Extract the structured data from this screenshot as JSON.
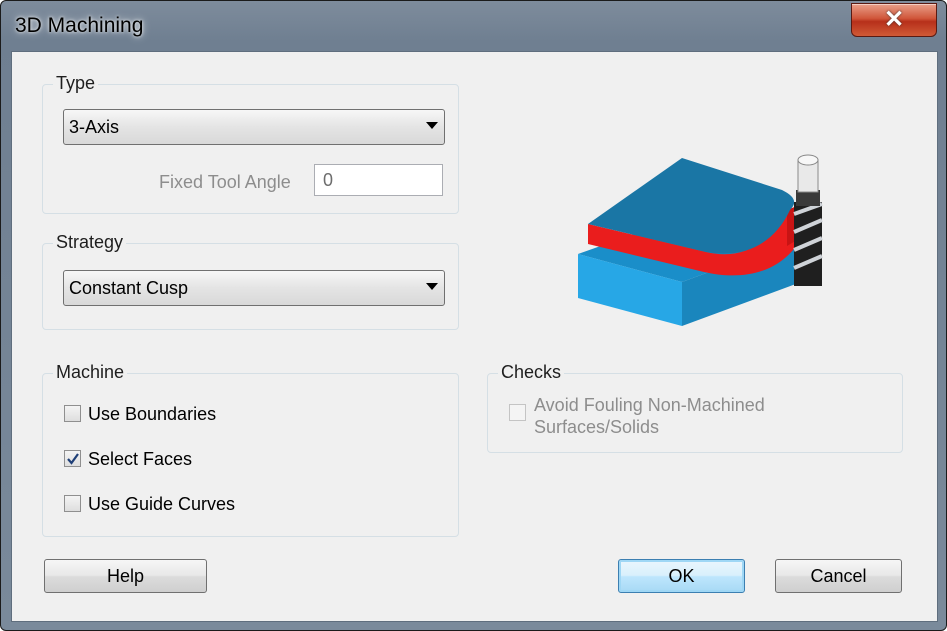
{
  "window": {
    "title": "3D Machining",
    "close_glyph": "✕"
  },
  "type_group": {
    "label": "Type",
    "selected": "3-Axis",
    "fixed_tool_angle_label": "Fixed Tool Angle",
    "fixed_tool_angle_value": "0"
  },
  "strategy_group": {
    "label": "Strategy",
    "selected": "Constant Cusp"
  },
  "machine_group": {
    "label": "Machine",
    "options": [
      {
        "label": "Use Boundaries",
        "checked": false
      },
      {
        "label": "Select Faces",
        "checked": true
      },
      {
        "label": "Use Guide Curves",
        "checked": false
      }
    ]
  },
  "checks_group": {
    "label": "Checks",
    "avoid_fouling_line1": "Avoid Fouling Non-Machined",
    "avoid_fouling_line2": "Surfaces/Solids",
    "avoid_fouling_checked": false,
    "avoid_fouling_enabled": false
  },
  "buttons": {
    "help": "Help",
    "ok": "OK",
    "cancel": "Cancel"
  },
  "colors": {
    "block_top": "#1a78a6",
    "block_red": "#ea1d1d",
    "block_base": "#1a92cd",
    "cutter_dark": "#2a2a2a",
    "default_button_border": "#3c7fb1"
  },
  "illustration": {
    "icon": "3d-machining-block-with-cutter"
  }
}
